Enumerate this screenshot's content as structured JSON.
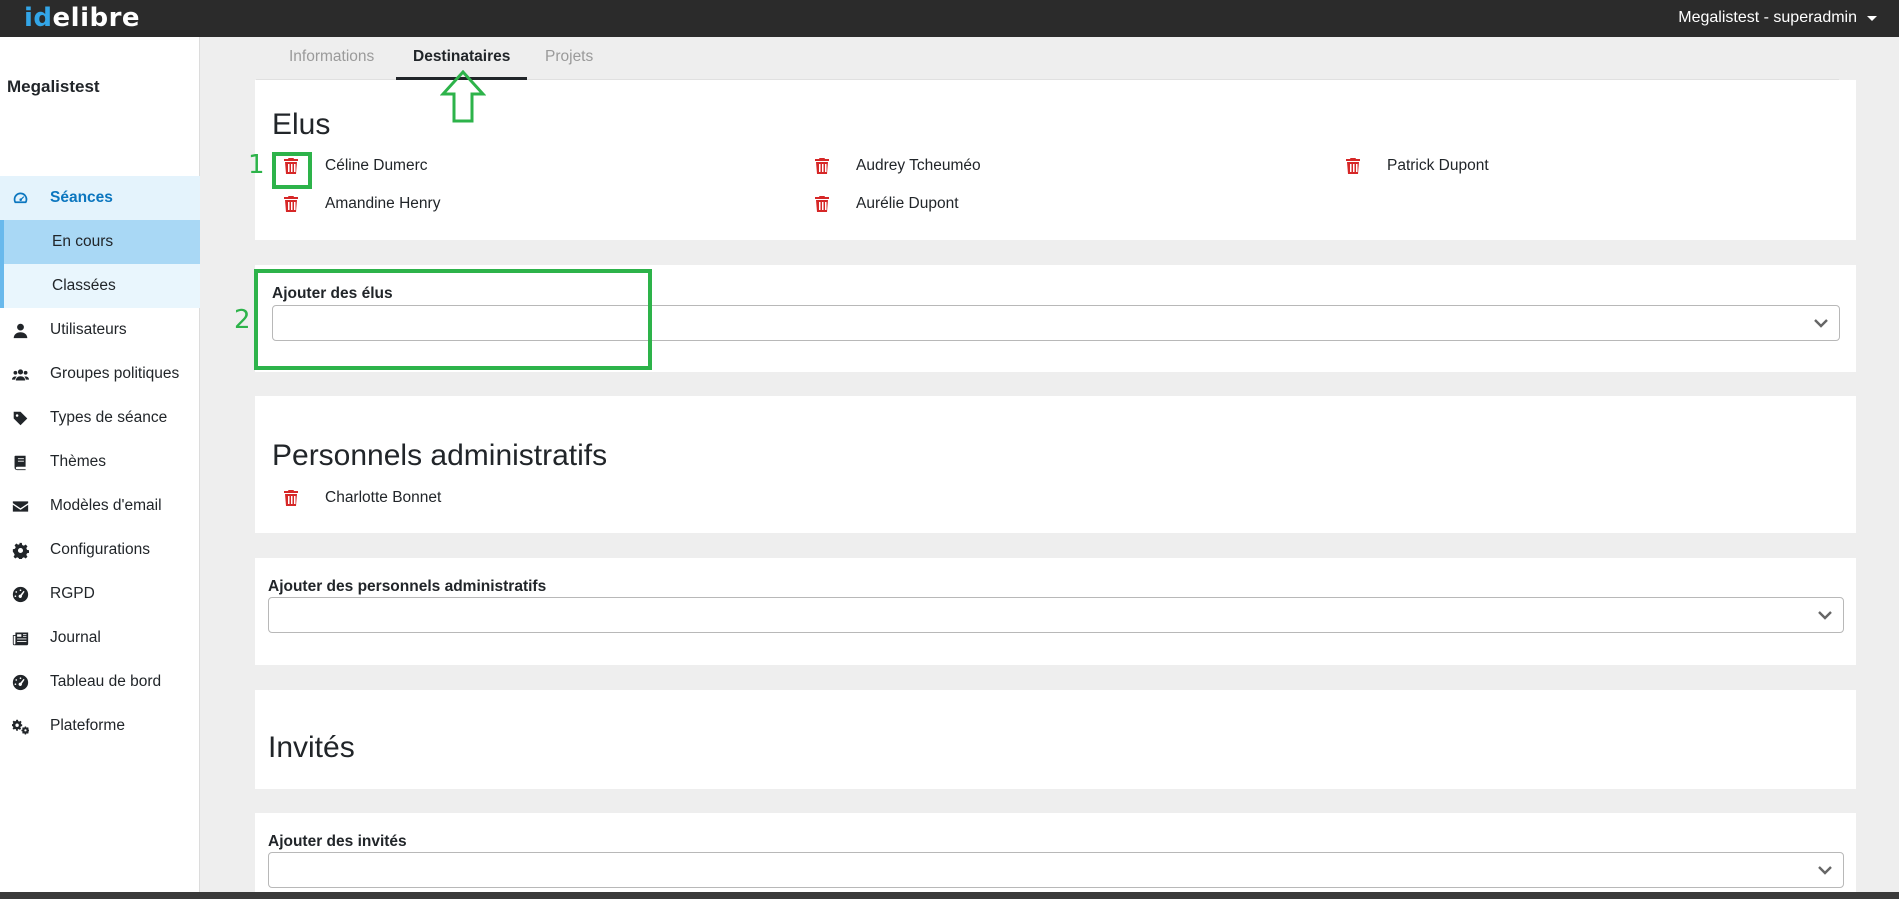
{
  "topbar": {
    "logo_id": "id",
    "logo_rest": "elibre",
    "user_label": "Megalistest - superadmin"
  },
  "sidebar": {
    "org_name": "Megalistest",
    "items": [
      {
        "label": "Séances",
        "icon": "dashboard-icon"
      },
      {
        "label": "En cours"
      },
      {
        "label": "Classées"
      },
      {
        "label": "Utilisateurs",
        "icon": "user-icon"
      },
      {
        "label": "Groupes politiques",
        "icon": "users-icon"
      },
      {
        "label": "Types de séance",
        "icon": "tag-icon"
      },
      {
        "label": "Thèmes",
        "icon": "book-icon"
      },
      {
        "label": "Modèles d'email",
        "icon": "envelope-icon"
      },
      {
        "label": "Configurations",
        "icon": "gear-icon"
      },
      {
        "label": "RGPD",
        "icon": "gauge-icon"
      },
      {
        "label": "Journal",
        "icon": "newspaper-icon"
      },
      {
        "label": "Tableau de bord",
        "icon": "gauge-icon"
      },
      {
        "label": "Plateforme",
        "icon": "gears-icon"
      }
    ]
  },
  "tabs": [
    {
      "label": "Informations"
    },
    {
      "label": "Destinataires"
    },
    {
      "label": "Projets"
    }
  ],
  "elus": {
    "title": "Elus",
    "people": [
      "Céline Dumerc",
      "Audrey Tcheuméo",
      "Patrick Dupont",
      "Amandine Henry",
      "Aurélie Dupont"
    ]
  },
  "add_elus": {
    "label": "Ajouter des élus",
    "value": ""
  },
  "personnels": {
    "title": "Personnels administratifs",
    "people": [
      "Charlotte Bonnet"
    ]
  },
  "add_personnels": {
    "label": "Ajouter des personnels administratifs",
    "value": ""
  },
  "invites": {
    "title": "Invités"
  },
  "add_invites": {
    "label": "Ajouter des invités",
    "value": ""
  },
  "annotations": {
    "num1": "1",
    "num2": "2",
    "color": "#2db34a"
  },
  "colors": {
    "topbar": "#2b2b2b",
    "accent": "#0b76bf",
    "trash": "#d62727"
  }
}
